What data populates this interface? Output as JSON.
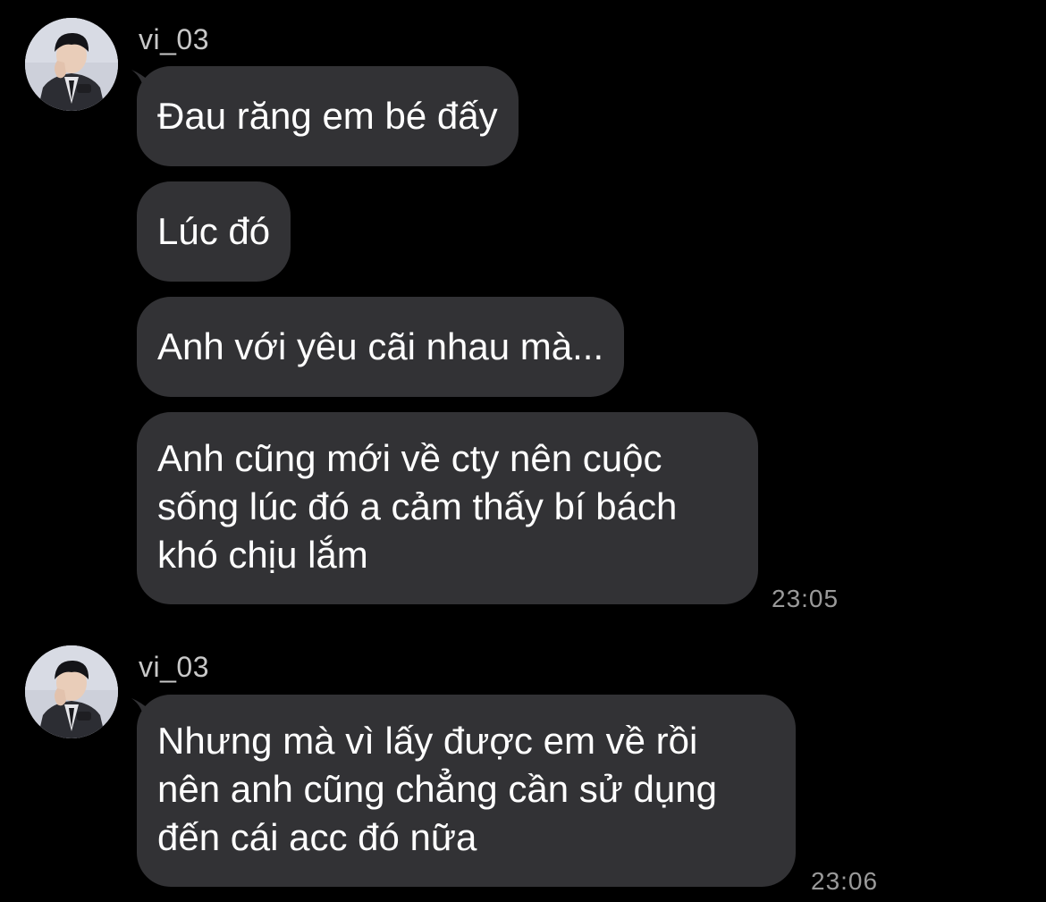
{
  "colors": {
    "background": "#000000",
    "bubble": "#323235",
    "message_text": "#ffffff",
    "sender_name": "#c8c8c8",
    "timestamp": "#9a9a9a"
  },
  "groups": [
    {
      "sender": "vi_03",
      "avatar_icon": "profile-photo-avatar",
      "messages": [
        {
          "text": "Đau răng em bé đấy"
        },
        {
          "text": "Lúc đó"
        },
        {
          "text": "Anh với yêu cãi nhau mà..."
        },
        {
          "lines": [
            "Anh cũng mới về cty nên cuộc",
            "sống lúc đó a cảm thấy bí bách",
            "khó chịu lắm"
          ]
        }
      ],
      "time": "23:05"
    },
    {
      "sender": "vi_03",
      "avatar_icon": "profile-photo-avatar",
      "messages": [
        {
          "lines": [
            "Nhưng mà vì lấy được em về rồi",
            "nên anh cũng chẳng cần sử dụng",
            "đến cái acc đó nữa"
          ]
        }
      ],
      "time": "23:06"
    }
  ]
}
